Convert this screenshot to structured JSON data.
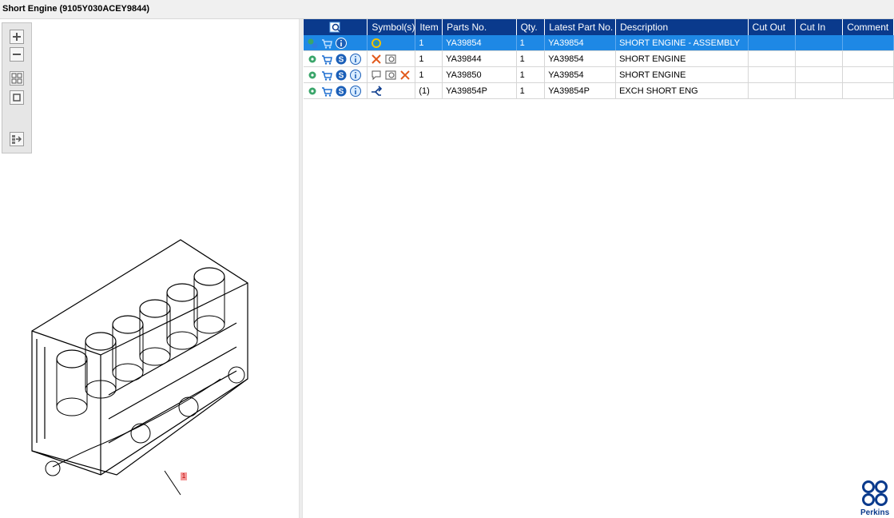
{
  "window": {
    "title": "Short Engine (9105Y030ACEY9844)"
  },
  "toolbar": {
    "buttons": [
      {
        "name": "zoom-in-button",
        "icon": "zoom-in-icon"
      },
      {
        "name": "zoom-out-button",
        "icon": "zoom-out-icon"
      },
      {
        "name": "fit-all-button",
        "icon": "fit-all-icon"
      },
      {
        "name": "fit-page-button",
        "icon": "fit-page-icon"
      },
      {
        "name": "export-button",
        "icon": "export-icon"
      }
    ]
  },
  "drawing": {
    "callout": "1"
  },
  "table": {
    "columns": [
      "",
      "Symbol(s)",
      "Item",
      "Parts No.",
      "Qty.",
      "Latest Part No.",
      "Description",
      "Cut Out",
      "Cut In",
      "Comment"
    ],
    "rows": [
      {
        "item": "1",
        "parts_no": "YA39854",
        "qty": "1",
        "latest": "YA39854",
        "description": "SHORT ENGINE - ASSEMBLY",
        "cut_out": "",
        "cut_in": "",
        "comment": "",
        "selected": true
      },
      {
        "item": "1",
        "parts_no": "YA39844",
        "qty": "1",
        "latest": "YA39854",
        "description": "SHORT ENGINE",
        "cut_out": "",
        "cut_in": "",
        "comment": "",
        "selected": false
      },
      {
        "item": "1",
        "parts_no": "YA39850",
        "qty": "1",
        "latest": "YA39854",
        "description": "SHORT ENGINE",
        "cut_out": "",
        "cut_in": "",
        "comment": "",
        "selected": false
      },
      {
        "item": "(1)",
        "parts_no": "YA39854P",
        "qty": "1",
        "latest": "YA39854P",
        "description": "EXCH SHORT ENG",
        "cut_out": "",
        "cut_in": "",
        "comment": "",
        "selected": false
      }
    ]
  },
  "brand": {
    "name": "Perkins",
    "color": "#0a3a8c"
  },
  "colors": {
    "header": "#0a3a8c",
    "selected_row": "#1e88e5"
  }
}
